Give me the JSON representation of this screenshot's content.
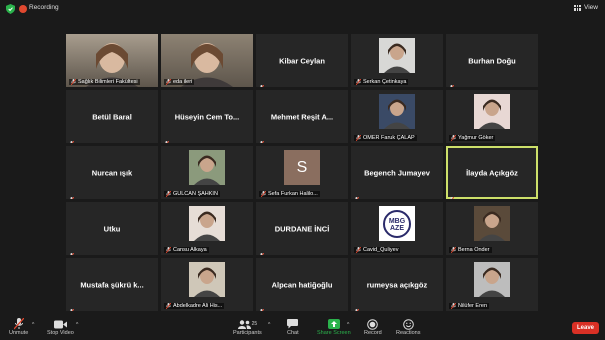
{
  "topbar": {
    "recording_label": "Recording",
    "view_label": "View"
  },
  "tiles": [
    {
      "kind": "video",
      "label": "Sağlık Bilimleri Fakültesi",
      "bg": "#a89d8e"
    },
    {
      "kind": "video",
      "label": "eda ileri",
      "bg": "#8d8273"
    },
    {
      "kind": "name",
      "name": "Kibar Ceylan"
    },
    {
      "kind": "photo",
      "label": "Serkan Çetinkaya",
      "bg": "#d8d8d6"
    },
    {
      "kind": "name",
      "name": "Burhan Doğu"
    },
    {
      "kind": "name",
      "name": "Betül Baral"
    },
    {
      "kind": "name",
      "name": "Hüseyin Cem To..."
    },
    {
      "kind": "name",
      "name": "Mehmet Reşit A..."
    },
    {
      "kind": "photo",
      "label": "ÖMER Faruk ÇALAP",
      "bg": "#3a4a66"
    },
    {
      "kind": "photo",
      "label": "Yağmur Göker",
      "bg": "#e8d8d4"
    },
    {
      "kind": "name",
      "name": "Nurcan ışık"
    },
    {
      "kind": "photo",
      "label": "GÜLCAN ŞAHKİN",
      "bg": "#8b9a7c"
    },
    {
      "kind": "avatar",
      "letter": "S",
      "label": "Sefa Furkan Halilo...",
      "bg": "#8a6e5f"
    },
    {
      "kind": "name",
      "name": "Begench Jumayev"
    },
    {
      "kind": "name",
      "name": "İlayda Açıkgöz",
      "active": true
    },
    {
      "kind": "name",
      "name": "Utku"
    },
    {
      "kind": "photo",
      "label": "Cansu Alkaya",
      "bg": "#e6ddd6"
    },
    {
      "kind": "name",
      "name": "DURDANE İNCİ"
    },
    {
      "kind": "photo",
      "label": "Cavid_Quliyev",
      "bg": "#ffffff",
      "logo": "MBG AZE"
    },
    {
      "kind": "photo",
      "label": "Berna Önder",
      "bg": "#5a4a3a"
    },
    {
      "kind": "name",
      "name": "Mustafa şükrü k..."
    },
    {
      "kind": "photo",
      "label": "Abdelkadre Ali His...",
      "bg": "#cfc7b8"
    },
    {
      "kind": "name",
      "name": "Alpcan hatiğoğlu"
    },
    {
      "kind": "name",
      "name": "rumeysa açıkgöz"
    },
    {
      "kind": "photo",
      "label": "Nilüfer Eren",
      "bg": "#bdbdbd"
    }
  ],
  "toolbar": {
    "unmute": "Unmute",
    "stop_video": "Stop Video",
    "participants": "Participants",
    "participants_count": "25",
    "chat": "Chat",
    "share_screen": "Share Screen",
    "record": "Record",
    "reactions": "Reactions",
    "leave": "Leave"
  },
  "colors": {
    "active_border": "#cde06a",
    "share_green": "#2bb24c",
    "leave_red": "#d93025"
  }
}
